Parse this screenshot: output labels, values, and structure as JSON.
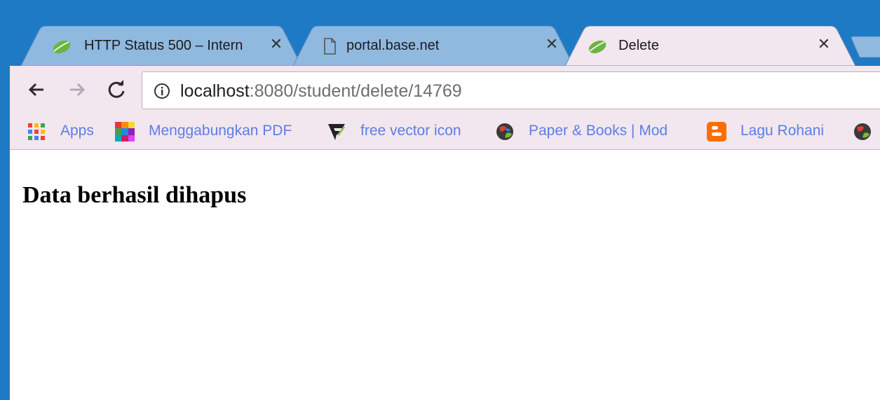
{
  "tabs": [
    {
      "title": "HTTP Status 500 – Intern",
      "favicon": "spring-leaf-icon",
      "active": false
    },
    {
      "title": "portal.base.net",
      "favicon": "document-icon",
      "active": false
    },
    {
      "title": "Delete",
      "favicon": "spring-leaf-icon",
      "active": true
    }
  ],
  "toolbar": {
    "url_host": "localhost",
    "url_path": ":8080/student/delete/14769",
    "back_icon": "arrow-left-icon",
    "forward_icon": "arrow-right-icon",
    "reload_icon": "reload-icon",
    "info_icon": "info-icon"
  },
  "bookmarks": [
    {
      "label": "Apps",
      "icon": "apps-grid-icon"
    },
    {
      "label": "Menggabungkan PDF",
      "icon": "color-grid-icon"
    },
    {
      "label": "free vector icon",
      "icon": "freepik-icon"
    },
    {
      "label": "Paper & Books | Mod",
      "icon": "globe-icon"
    },
    {
      "label": "Lagu Rohani",
      "icon": "blogger-icon"
    }
  ],
  "page": {
    "heading": "Data berhasil dihapus"
  },
  "colors": {
    "frame": "#1f7ac6",
    "inactive_tab": "#90b9e0",
    "active_tab": "#f2e6ef",
    "link": "#5c7ee6"
  }
}
